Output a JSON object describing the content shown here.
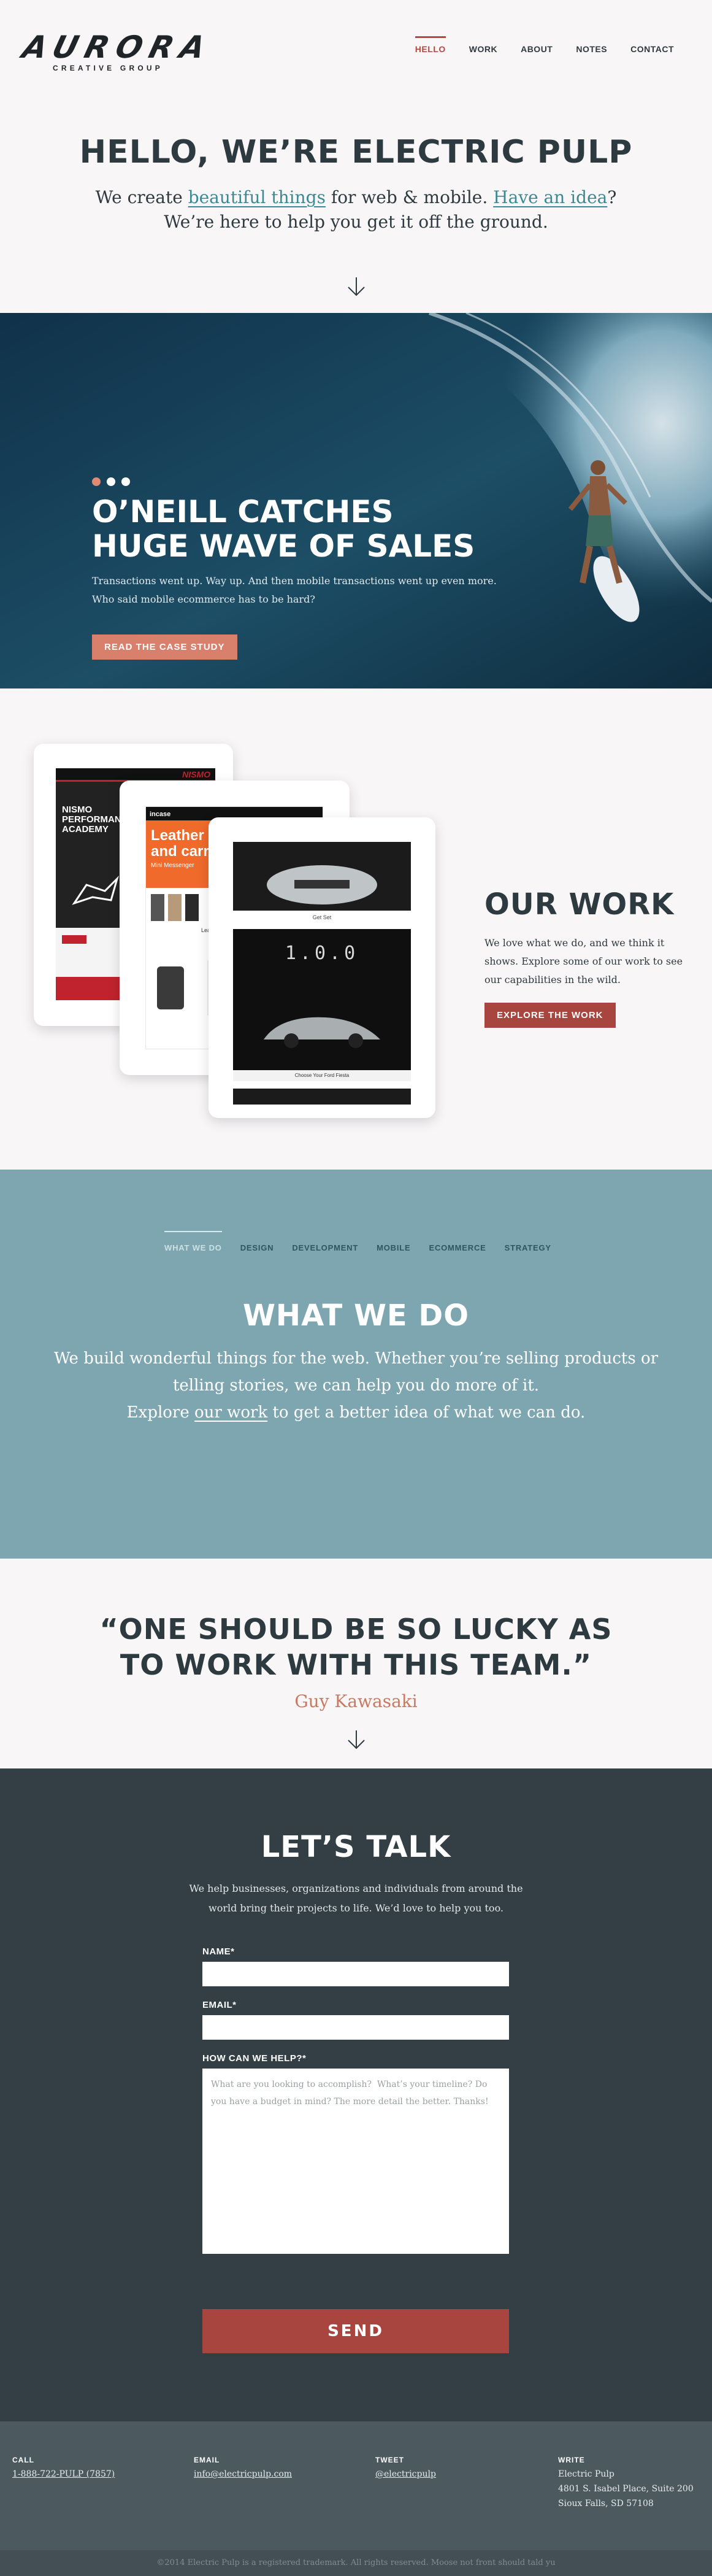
{
  "brand": {
    "logo_word": "AURORA",
    "logo_sub": "CREATIVE GROUP"
  },
  "nav": [
    {
      "label": "HELLO",
      "active": true
    },
    {
      "label": "WORK",
      "active": false
    },
    {
      "label": "ABOUT",
      "active": false
    },
    {
      "label": "NOTES",
      "active": false
    },
    {
      "label": "CONTACT",
      "active": false
    }
  ],
  "hero": {
    "title": "HELLO, WE’RE ELECTRIC PULP",
    "line1_pre": "We create ",
    "line1_link1": "beautiful things",
    "line1_mid": " for web & mobile.  ",
    "line1_link2": "Have an idea",
    "line1_post": "?",
    "line2": "We’re here to help you get it off the ground.",
    "arrow_icon": "arrow-down-icon"
  },
  "case_study": {
    "slides": 3,
    "active_slide": 1,
    "title_line1": "O’NEILL CATCHES",
    "title_line2": "HUGE WAVE OF SALES",
    "text": "Transactions went up. Way up. And then mobile transactions went up even more. Who said mobile ecommerce has to be hard?",
    "button": "READ THE CASE STUDY"
  },
  "work": {
    "title": "OUR WORK",
    "text": "We love what we do, and we think it shows. Explore some of our work to see our capabilities in the wild.",
    "button": "EXPLORE THE WORK",
    "device1": {
      "brand": "NISMO",
      "heading": "NISMO PERFORMANCE ACADEMY"
    },
    "device2": {
      "brand": "incase",
      "heading1": "Leather",
      "heading2": "and carry",
      "sub": "Mini Messenger",
      "product": "Leather Mini Case"
    },
    "device3": {
      "caption": "Get Set",
      "counter": "1.0.0",
      "footer": "Choose Your Ford Fiesta"
    }
  },
  "what_we_do": {
    "tabs": [
      "WHAT WE DO",
      "DESIGN",
      "DEVELOPMENT",
      "MOBILE",
      "ECOMMERCE",
      "STRATEGY"
    ],
    "title": "WHAT WE DO",
    "text": "We build wonderful things for the web. Whether you’re selling products or telling stories, we can help you do more of it.",
    "explore_pre": "Explore ",
    "explore_link": "our work",
    "explore_post": " to get a better idea of what we can do."
  },
  "quote": {
    "line1": "“ONE SHOULD BE SO LUCKY AS",
    "line2": "TO WORK WITH THIS TEAM.”",
    "author": "Guy Kawasaki"
  },
  "talk": {
    "title": "LET’S TALK",
    "text": "We help businesses, organizations and individuals from around the world bring their projects to life. We’d love to help you too.",
    "name_label": "NAME*",
    "email_label": "EMAIL*",
    "help_label": "HOW CAN WE HELP?*",
    "help_placeholder": "What are you looking to accomplish?  What’s your timeline? Do you have a budget in mind? The more detail the better. Thanks!",
    "send": "SEND"
  },
  "footer": {
    "call_label": "CALL",
    "call_value": "1-888-722-PULP (7857)",
    "email_label": "EMAIL",
    "email_value": "info@electricpulp.com",
    "tweet_label": "TWEET",
    "tweet_value": "@electricpulp",
    "write_label": "WRITE",
    "write_line1": "Electric Pulp",
    "write_line2": "4801 S. Isabel Place, Suite 200",
    "write_line3": "Sioux Falls, SD 57108",
    "copyright": "©2014 Electric Pulp is a registered trademark. All rights reserved. Moose not front should tald yu"
  },
  "colors": {
    "accent_red": "#b5483f",
    "button_red": "#a8453f",
    "salmon": "#d9806c",
    "teal_link": "#3b8a93",
    "section_teal": "#7ea6b0",
    "dark_section": "#333f45"
  }
}
